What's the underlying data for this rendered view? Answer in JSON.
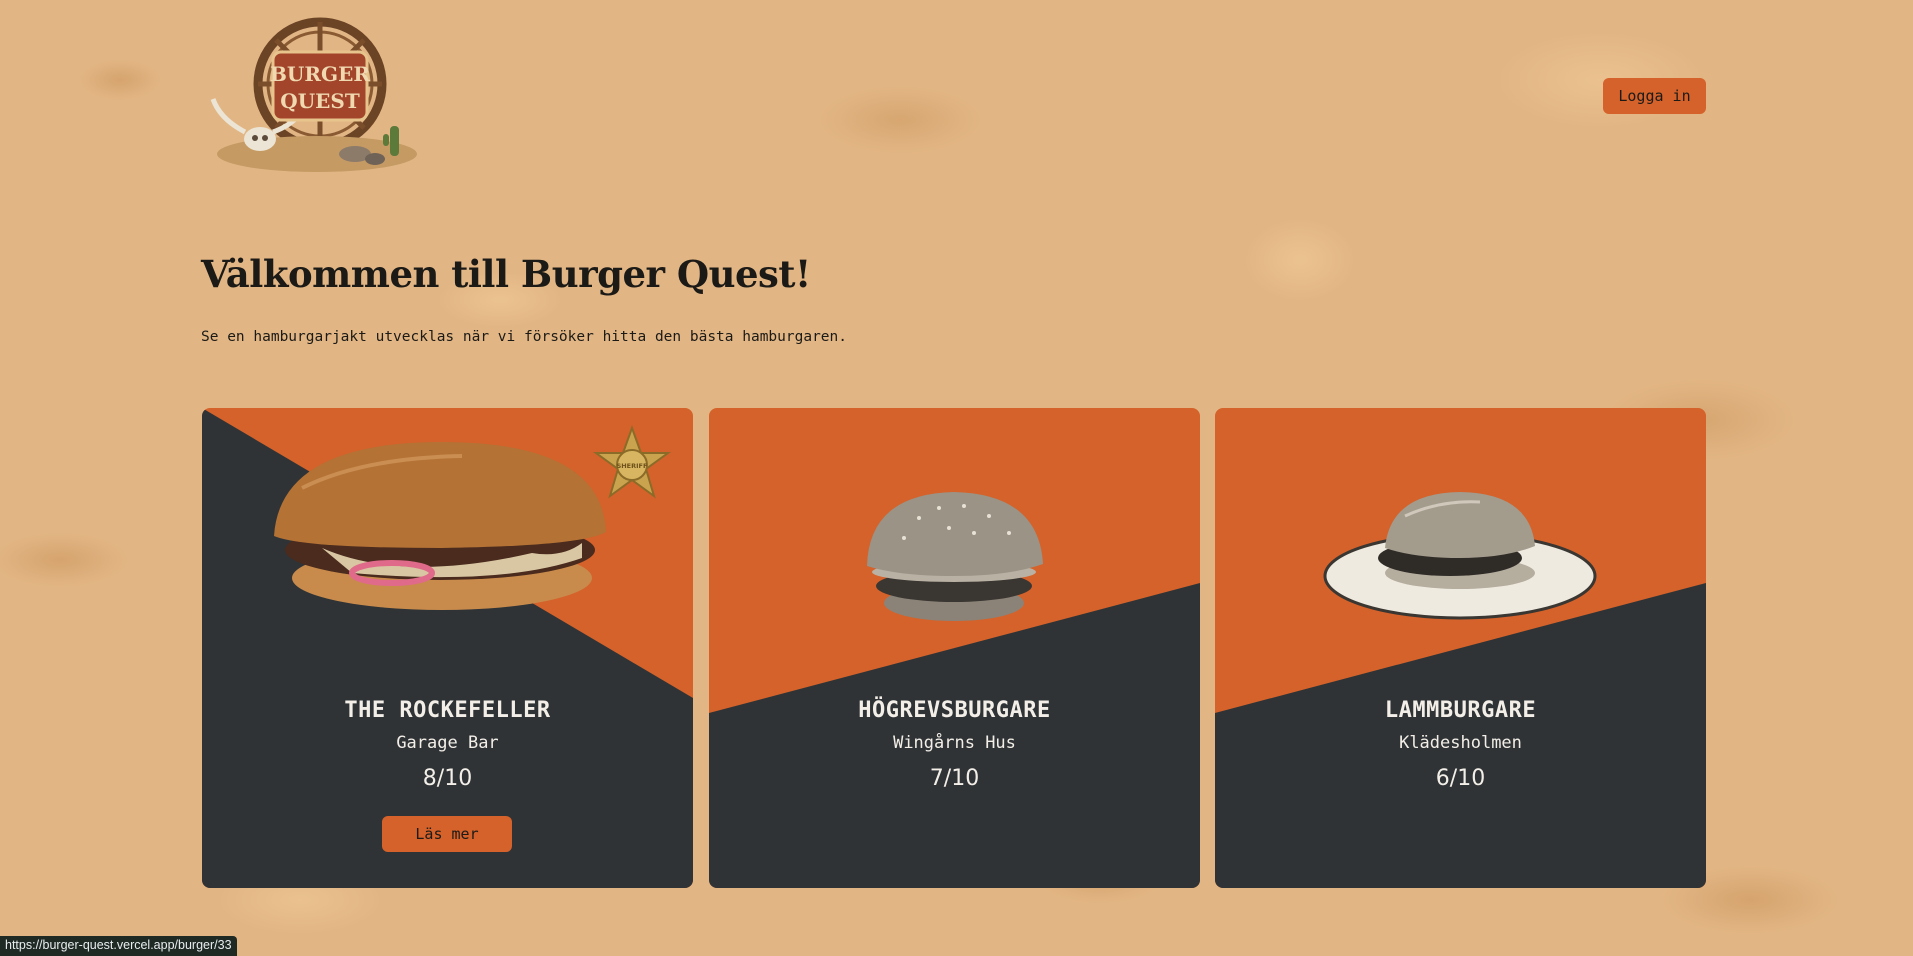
{
  "header": {
    "logo_text_line1": "BURGER",
    "logo_text_line2": "QUEST",
    "login_label": "Logga in"
  },
  "hero": {
    "title": "Välkommen till Burger Quest!",
    "subtitle": "Se en hamburgarjakt utvecklas när vi försöker hitta den bästa hamburgaren."
  },
  "cards": [
    {
      "name": "THE ROCKEFELLER",
      "place": "Garage Bar",
      "score": "8/10",
      "button_label": "Läs mer",
      "badge_text": "SHERIFF"
    },
    {
      "name": "HÖGREVSBURGARE",
      "place": "Wingårns Hus",
      "score": "7/10"
    },
    {
      "name": "LAMMBURGARE",
      "place": "Klädesholmen",
      "score": "6/10"
    }
  ],
  "status_bar": {
    "url": "https://burger-quest.vercel.app/burger/33"
  },
  "colors": {
    "accent": "#d4622a",
    "dark": "#2f3336",
    "background": "#e2b684",
    "text": "#1c1a17"
  },
  "icons": [
    "burger-quest-logo",
    "sheriff-badge-icon"
  ]
}
